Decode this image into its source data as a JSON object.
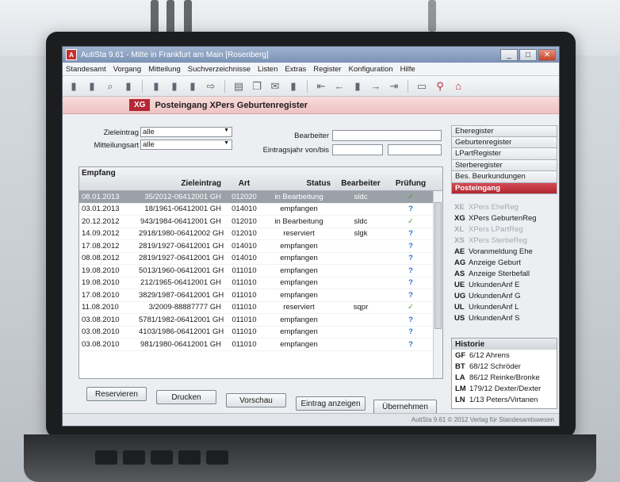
{
  "window": {
    "title": "AutiSta 9.61 - Mitte in Frankfurt am Main [Rosenberg]",
    "app_icon_letter": "A"
  },
  "menu": [
    "Standesamt",
    "Vorgang",
    "Mitteilung",
    "Suchverzeichnisse",
    "Listen",
    "Extras",
    "Register",
    "Konfiguration",
    "Hilfe"
  ],
  "banner": {
    "tag": "XG",
    "title": "Posteingang XPers Geburtenregister"
  },
  "filters": {
    "zieleintrag_label": "Zieleintrag",
    "zieleintrag_value": "alle",
    "mitteilungsart_label": "Mitteilungsart",
    "mitteilungsart_value": "alle",
    "bearbeiter_label": "Bearbeiter",
    "eintragsjahr_label": "Eintragsjahr von/bis"
  },
  "table": {
    "headers": {
      "empfang": "Empfang",
      "zieleintrag": "Zieleintrag",
      "art": "Art",
      "status": "Status",
      "bearbeiter": "Bearbeiter",
      "pruefung": "Prüfung"
    },
    "rows": [
      {
        "date": "08.01.2013",
        "ziel": "35/2012-06412001 GH",
        "art": "012020",
        "status": "in Bearbeitung",
        "bearb": "sldc",
        "check": "ok"
      },
      {
        "date": "03.01.2013",
        "ziel": "18/1961-06412001 GH",
        "art": "014010",
        "status": "empfangen",
        "bearb": "",
        "check": "q"
      },
      {
        "date": "20.12.2012",
        "ziel": "943/1984-06412001 GH",
        "art": "012010",
        "status": "in Bearbeitung",
        "bearb": "sldc",
        "check": "ok"
      },
      {
        "date": "14.09.2012",
        "ziel": "2918/1980-06412002 GH",
        "art": "012010",
        "status": "reserviert",
        "bearb": "slgk",
        "check": "q"
      },
      {
        "date": "17.08.2012",
        "ziel": "2819/1927-06412001 GH",
        "art": "014010",
        "status": "empfangen",
        "bearb": "",
        "check": "q"
      },
      {
        "date": "08.08.2012",
        "ziel": "2819/1927-06412001 GH",
        "art": "014010",
        "status": "empfangen",
        "bearb": "",
        "check": "q"
      },
      {
        "date": "19.08.2010",
        "ziel": "5013/1960-06412001 GH",
        "art": "011010",
        "status": "empfangen",
        "bearb": "",
        "check": "q"
      },
      {
        "date": "19.08.2010",
        "ziel": "212/1965-06412001 GH",
        "art": "011010",
        "status": "empfangen",
        "bearb": "",
        "check": "q"
      },
      {
        "date": "17.08.2010",
        "ziel": "3829/1987-06412001 GH",
        "art": "011010",
        "status": "empfangen",
        "bearb": "",
        "check": "q"
      },
      {
        "date": "11.08.2010",
        "ziel": "3/2009-88887777 GH",
        "art": "011010",
        "status": "reserviert",
        "bearb": "sqpr",
        "check": "ok"
      },
      {
        "date": "03.08.2010",
        "ziel": "5781/1982-06412001 GH",
        "art": "011010",
        "status": "empfangen",
        "bearb": "",
        "check": "q"
      },
      {
        "date": "03.08.2010",
        "ziel": "4103/1986-06412001 GH",
        "art": "011010",
        "status": "empfangen",
        "bearb": "",
        "check": "q"
      },
      {
        "date": "03.08.2010",
        "ziel": "981/1980-06412001 GH",
        "art": "011010",
        "status": "empfangen",
        "bearb": "",
        "check": "q"
      }
    ]
  },
  "buttons": {
    "reservieren": "Reservieren",
    "drucken": "Drucken",
    "vorschau": "Vorschau",
    "eintrag_anzeigen": "Eintrag anzeigen",
    "uebernehmen": "Übernehmen"
  },
  "nav": [
    {
      "label": "Eheregister",
      "active": false
    },
    {
      "label": "Geburtenregister",
      "active": false
    },
    {
      "label": "LPartRegister",
      "active": false
    },
    {
      "label": "Sterberegister",
      "active": false
    },
    {
      "label": "Bes. Beurkundungen",
      "active": false
    },
    {
      "label": "Posteingang",
      "active": true
    }
  ],
  "registers": [
    {
      "code": "XE",
      "label": "XPers EheReg",
      "dim": true
    },
    {
      "code": "XG",
      "label": "XPers GeburtenReg",
      "dim": false
    },
    {
      "code": "XL",
      "label": "XPers LPartReg",
      "dim": true
    },
    {
      "code": "XS",
      "label": "XPers SterbeReg",
      "dim": true
    },
    {
      "code": "AE",
      "label": "Voranmeldung Ehe",
      "dim": false
    },
    {
      "code": "AG",
      "label": "Anzeige Geburt",
      "dim": false
    },
    {
      "code": "AS",
      "label": "Anzeige Sterbefall",
      "dim": false
    },
    {
      "code": "UE",
      "label": "UrkundenAnf E",
      "dim": false
    },
    {
      "code": "UG",
      "label": "UrkundenAnf G",
      "dim": false
    },
    {
      "code": "UL",
      "label": "UrkundenAnf L",
      "dim": false
    },
    {
      "code": "US",
      "label": "UrkundenAnf S",
      "dim": false
    }
  ],
  "historie": {
    "title": "Historie",
    "items": [
      {
        "code": "GF",
        "label": "6/12 Ahrens"
      },
      {
        "code": "BT",
        "label": "68/12 Schröder"
      },
      {
        "code": "LA",
        "label": "86/12 Reinke/Bronke"
      },
      {
        "code": "LM",
        "label": "179/12 Dexter/Dexter"
      },
      {
        "code": "LN",
        "label": "1/13 Peters/Virtanen"
      }
    ]
  },
  "statusbar": "AutiSta 9.61  © 2012 Verlag für Standesamtswesen",
  "colors": {
    "accent": "#b52734",
    "title_bar": "#7b93b6",
    "check": "#4aa52c",
    "question": "#2a6fd0"
  },
  "icons": {
    "check": "✓",
    "question": "?"
  }
}
